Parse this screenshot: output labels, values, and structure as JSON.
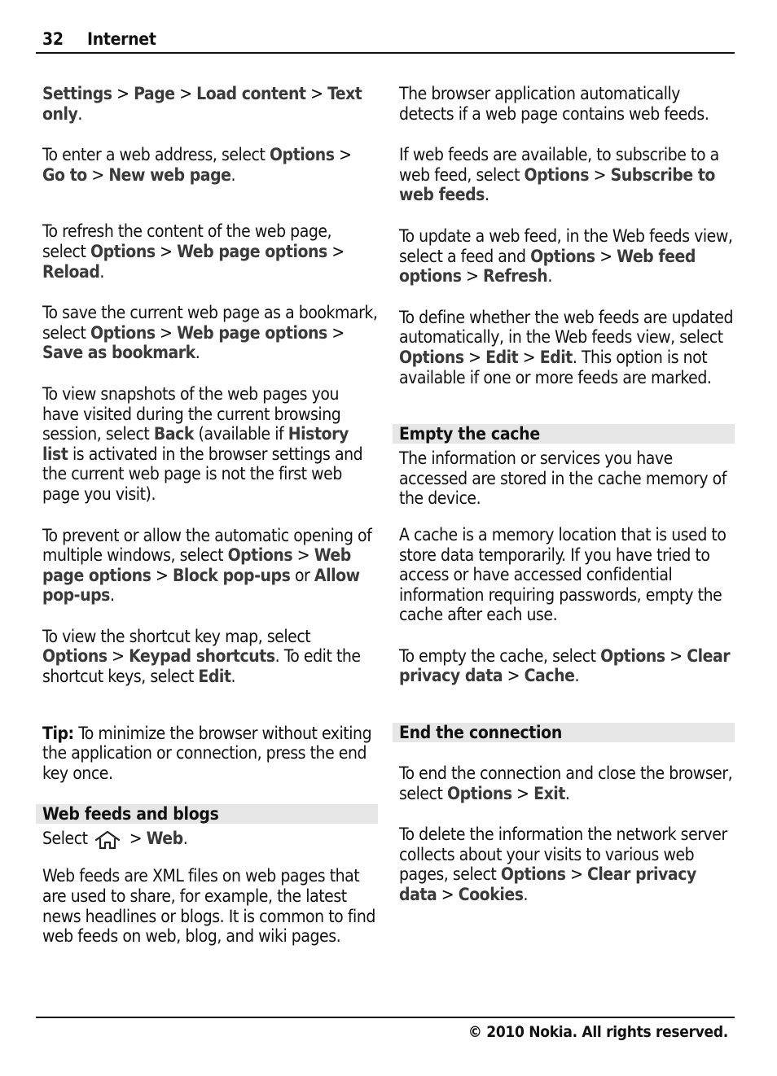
{
  "header": {
    "page_number": "32",
    "chapter": "Internet"
  },
  "footer": {
    "copyright": "© 2010 Nokia. All rights reserved."
  },
  "left_column": [
    {
      "type": "p",
      "gap": 0,
      "runs": [
        {
          "t": "b",
          "v": "Settings"
        },
        {
          "t": "n",
          "v": "  > "
        },
        {
          "t": "b",
          "v": "Page"
        },
        {
          "t": "n",
          "v": "  > "
        },
        {
          "t": "b",
          "v": "Load content"
        },
        {
          "t": "n",
          "v": "  > "
        },
        {
          "t": "b",
          "v": "Text only"
        },
        {
          "t": "n",
          "v": "."
        }
      ]
    },
    {
      "type": "p",
      "gap": 26,
      "runs": [
        {
          "t": "n",
          "v": "To enter a web address, select "
        },
        {
          "t": "b",
          "v": "Options"
        },
        {
          "t": "n",
          "v": "  > "
        },
        {
          "t": "b",
          "v": "Go to"
        },
        {
          "t": "n",
          "v": "  > "
        },
        {
          "t": "b",
          "v": "New web page"
        },
        {
          "t": "n",
          "v": "."
        }
      ]
    },
    {
      "type": "p",
      "gap": 45,
      "runs": [
        {
          "t": "n",
          "v": "To refresh the content of the web page, select "
        },
        {
          "t": "b",
          "v": "Options"
        },
        {
          "t": "n",
          "v": "  > "
        },
        {
          "t": "b",
          "v": "Web page options"
        },
        {
          "t": "n",
          "v": "  > "
        },
        {
          "t": "b",
          "v": "Reload"
        },
        {
          "t": "n",
          "v": "."
        }
      ]
    },
    {
      "type": "p",
      "gap": 26,
      "runs": [
        {
          "t": "n",
          "v": "To save the current web page as a bookmark, select "
        },
        {
          "t": "b",
          "v": "Options"
        },
        {
          "t": "n",
          "v": "  > "
        },
        {
          "t": "b",
          "v": "Web page options"
        },
        {
          "t": "n",
          "v": "  > "
        },
        {
          "t": "b",
          "v": "Save as bookmark"
        },
        {
          "t": "n",
          "v": "."
        }
      ]
    },
    {
      "type": "p",
      "gap": 26,
      "runs": [
        {
          "t": "n",
          "v": "To view snapshots of the web pages you have visited during the current browsing session, select "
        },
        {
          "t": "b",
          "v": "Back"
        },
        {
          "t": "n",
          "v": " (available if "
        },
        {
          "t": "b",
          "v": "History list"
        },
        {
          "t": "n",
          "v": " is activated in the browser settings and the current web page is not the first web page you visit)."
        }
      ]
    },
    {
      "type": "p",
      "gap": 26,
      "runs": [
        {
          "t": "n",
          "v": "To prevent or allow the automatic opening of multiple windows, select "
        },
        {
          "t": "b",
          "v": "Options"
        },
        {
          "t": "n",
          "v": "  > "
        },
        {
          "t": "b",
          "v": "Web page options"
        },
        {
          "t": "n",
          "v": "  > "
        },
        {
          "t": "b",
          "v": "Block pop-ups"
        },
        {
          "t": "n",
          "v": " or "
        },
        {
          "t": "b",
          "v": "Allow pop-ups"
        },
        {
          "t": "n",
          "v": "."
        }
      ]
    },
    {
      "type": "p",
      "gap": 26,
      "runs": [
        {
          "t": "n",
          "v": "To view the shortcut key map, select "
        },
        {
          "t": "b",
          "v": "Options"
        },
        {
          "t": "n",
          "v": "  > "
        },
        {
          "t": "b",
          "v": "Keypad shortcuts"
        },
        {
          "t": "n",
          "v": ". To edit the shortcut keys, select "
        },
        {
          "t": "b",
          "v": "Edit"
        },
        {
          "t": "n",
          "v": "."
        }
      ]
    },
    {
      "type": "p",
      "gap": 45,
      "runs": [
        {
          "t": "s",
          "v": "Tip:"
        },
        {
          "t": "n",
          "v": " To minimize the browser without exiting the application or connection, press the end key once."
        }
      ]
    },
    {
      "type": "h2",
      "gap": 26,
      "text": "Web feeds and blogs"
    },
    {
      "type": "p",
      "gap": 6,
      "runs": [
        {
          "t": "n",
          "v": "Select "
        },
        {
          "t": "icon",
          "v": "home-icon"
        },
        {
          "t": "n",
          "v": " > "
        },
        {
          "t": "b",
          "v": "Web"
        },
        {
          "t": "n",
          "v": "."
        }
      ]
    },
    {
      "type": "p",
      "gap": 20,
      "runs": [
        {
          "t": "n",
          "v": "Web feeds are XML files on web pages that are used to share, for example, the latest news headlines or blogs. It is common to find web feeds on web, blog, and wiki pages."
        }
      ]
    }
  ],
  "right_column": [
    {
      "type": "p",
      "gap": 0,
      "runs": [
        {
          "t": "n",
          "v": "The browser application automatically detects if a web page contains web feeds."
        }
      ]
    },
    {
      "type": "p",
      "gap": 26,
      "runs": [
        {
          "t": "n",
          "v": "If web feeds are available, to subscribe to a web feed, select "
        },
        {
          "t": "b",
          "v": "Options"
        },
        {
          "t": "n",
          "v": "  > "
        },
        {
          "t": "b",
          "v": "Subscribe to web feeds"
        },
        {
          "t": "n",
          "v": "."
        }
      ]
    },
    {
      "type": "p",
      "gap": 26,
      "runs": [
        {
          "t": "n",
          "v": "To update a web feed, in the Web feeds view, select a feed and "
        },
        {
          "t": "b",
          "v": "Options"
        },
        {
          "t": "n",
          "v": "  > "
        },
        {
          "t": "b",
          "v": "Web feed options"
        },
        {
          "t": "n",
          "v": "  > "
        },
        {
          "t": "b",
          "v": "Refresh"
        },
        {
          "t": "n",
          "v": "."
        }
      ]
    },
    {
      "type": "p",
      "gap": 26,
      "runs": [
        {
          "t": "n",
          "v": "To define whether the web feeds are updated automatically, in the Web feeds view, select "
        },
        {
          "t": "b",
          "v": "Options"
        },
        {
          "t": "n",
          "v": "  > "
        },
        {
          "t": "b",
          "v": "Edit"
        },
        {
          "t": "n",
          "v": "  > "
        },
        {
          "t": "b",
          "v": "Edit"
        },
        {
          "t": "n",
          "v": ". This option is not available if one or more feeds are marked."
        }
      ]
    },
    {
      "type": "h2",
      "gap": 45,
      "text": "Empty the cache"
    },
    {
      "type": "p",
      "gap": 6,
      "runs": [
        {
          "t": "n",
          "v": "The information or services you have accessed are stored in the cache memory of the device."
        }
      ]
    },
    {
      "type": "p",
      "gap": 20,
      "runs": [
        {
          "t": "n",
          "v": "A cache is a memory location that is used to store data temporarily. If you have tried to access or have accessed confidential information requiring passwords, empty the cache after each use."
        }
      ]
    },
    {
      "type": "p",
      "gap": 26,
      "runs": [
        {
          "t": "n",
          "v": "To empty the cache, select "
        },
        {
          "t": "b",
          "v": "Options"
        },
        {
          "t": "n",
          "v": "  > "
        },
        {
          "t": "b",
          "v": "Clear privacy data"
        },
        {
          "t": "n",
          "v": "  > "
        },
        {
          "t": "b",
          "v": "Cache"
        },
        {
          "t": "n",
          "v": "."
        }
      ]
    },
    {
      "type": "h2",
      "gap": 45,
      "text": "End the connection"
    },
    {
      "type": "p",
      "gap": 26,
      "runs": [
        {
          "t": "n",
          "v": "To end the connection and close the browser, select "
        },
        {
          "t": "b",
          "v": "Options"
        },
        {
          "t": "n",
          "v": "  > "
        },
        {
          "t": "b",
          "v": "Exit"
        },
        {
          "t": "n",
          "v": "."
        }
      ]
    },
    {
      "type": "p",
      "gap": 26,
      "runs": [
        {
          "t": "n",
          "v": "To delete the information the network server collects about your visits to various web pages, select "
        },
        {
          "t": "b",
          "v": "Options"
        },
        {
          "t": "n",
          "v": "  > "
        },
        {
          "t": "b",
          "v": "Clear privacy data"
        },
        {
          "t": "n",
          "v": "  > "
        },
        {
          "t": "b",
          "v": "Cookies"
        },
        {
          "t": "n",
          "v": "."
        }
      ]
    }
  ]
}
